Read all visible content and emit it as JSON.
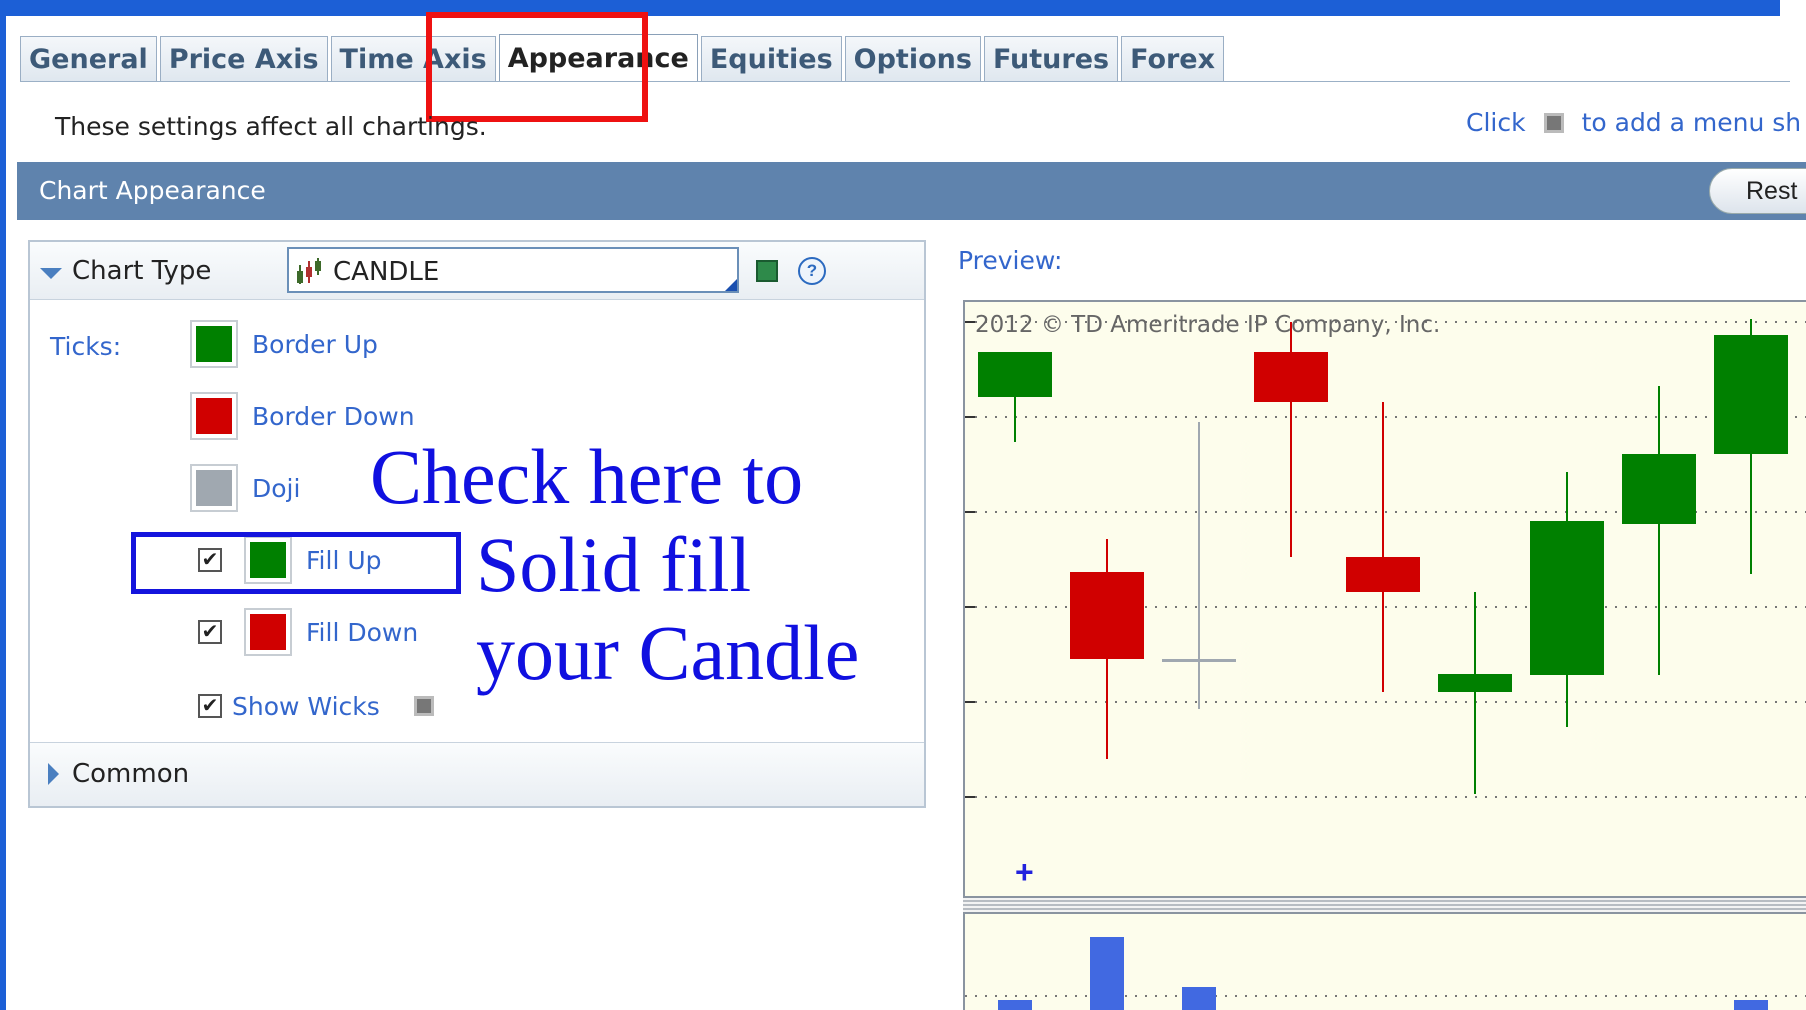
{
  "tabs": [
    {
      "label": "General",
      "active": false
    },
    {
      "label": "Price Axis",
      "active": false
    },
    {
      "label": "Time Axis",
      "active": false
    },
    {
      "label": "Appearance",
      "active": true
    },
    {
      "label": "Equities",
      "active": false
    },
    {
      "label": "Options",
      "active": false
    },
    {
      "label": "Futures",
      "active": false
    },
    {
      "label": "Forex",
      "active": false
    }
  ],
  "info_text": "These settings affect all chartings.",
  "hint": {
    "click": "Click",
    "rest": "to add a menu sh"
  },
  "section": {
    "title": "Chart Appearance",
    "reset_label": "Rest"
  },
  "chart_type": {
    "label": "Chart Type",
    "value": "CANDLE"
  },
  "ticks": {
    "label": "Ticks:",
    "border_up": {
      "label": "Border Up",
      "color": "#008000"
    },
    "border_down": {
      "label": "Border Down",
      "color": "#d00000"
    },
    "doji": {
      "label": "Doji",
      "color": "#a0a8b0"
    },
    "fill_up": {
      "label": "Fill Up",
      "checked": true,
      "color": "#008000"
    },
    "fill_down": {
      "label": "Fill Down",
      "checked": true,
      "color": "#d00000"
    },
    "show_wicks": {
      "label": "Show Wicks",
      "checked": true
    }
  },
  "common_label": "Common",
  "annotation": {
    "line1": "Check here to",
    "line2": "Solid fill",
    "line3": "your Candle"
  },
  "preview": {
    "label": "Preview:",
    "copyright": "2012 © TD Ameritrade IP Company, Inc.",
    "candles": [
      {
        "dir": "up",
        "high": 80,
        "open": 50,
        "close": 95,
        "low": 140
      },
      {
        "dir": "down",
        "high": 237,
        "open": 270,
        "close": 357,
        "low": 457
      },
      {
        "dir": "doji",
        "high": 120,
        "open": 357,
        "close": 357,
        "low": 407
      },
      {
        "dir": "down",
        "high": 20,
        "open": 50,
        "close": 100,
        "low": 255
      },
      {
        "dir": "down",
        "high": 100,
        "open": 255,
        "close": 290,
        "low": 390
      },
      {
        "dir": "up",
        "high": 290,
        "open": 390,
        "close": 372,
        "low": 492
      },
      {
        "dir": "up",
        "high": 170,
        "open": 373,
        "close": 219,
        "low": 425
      },
      {
        "dir": "up",
        "high": 84,
        "open": 222,
        "close": 152,
        "low": 373
      },
      {
        "dir": "up",
        "high": 17,
        "open": 152,
        "close": 33,
        "low": 272
      }
    ],
    "volume": [
      12,
      75,
      25,
      0,
      0,
      0,
      0,
      0,
      12
    ]
  },
  "colors": {
    "up": "#008000",
    "down": "#d00000",
    "doji": "#a0a8b0",
    "volume": "#4169e1"
  }
}
